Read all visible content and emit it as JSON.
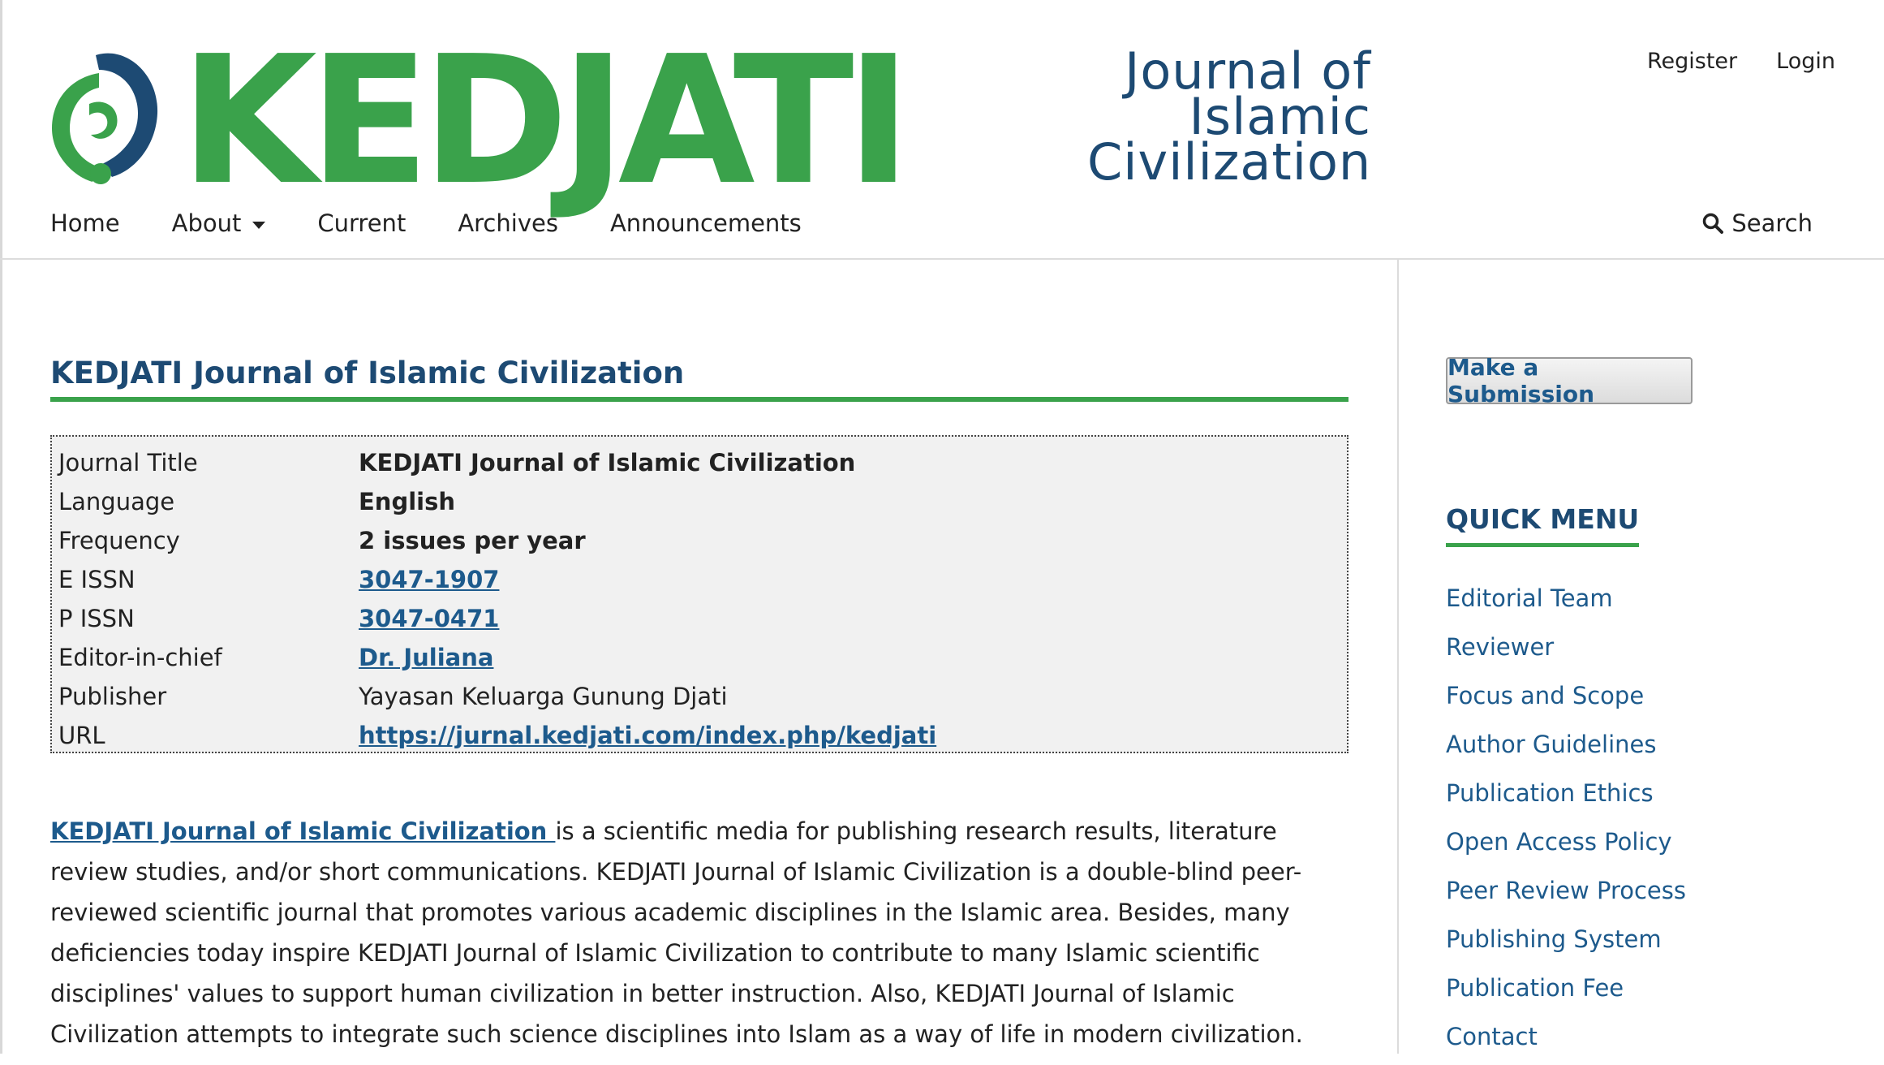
{
  "header": {
    "logo_text": "KEDJATI",
    "logo_sub_line1": "Journal of",
    "logo_sub_line2": "Islamic",
    "logo_sub_line3": "Civilization",
    "brand_green": "#3aa24b",
    "brand_blue": "#1d4a73"
  },
  "user_nav": {
    "register": "Register",
    "login": "Login"
  },
  "main_nav": {
    "home": "Home",
    "about": "About",
    "current": "Current",
    "archives": "Archives",
    "announcements": "Announcements",
    "search": "Search"
  },
  "main": {
    "title": "KEDJATI Journal of Islamic Civilization",
    "info": [
      {
        "label": "Journal Title",
        "value": "KEDJATI Journal of Islamic Civilization"
      },
      {
        "label": "Language",
        "value": "English"
      },
      {
        "label": "Frequency",
        "value": "2 issues per year"
      },
      {
        "label": "E ISSN",
        "value": "3047-1907"
      },
      {
        "label": "P ISSN",
        "value": "3047-0471"
      },
      {
        "label": "Editor-in-chief",
        "value": "Dr. Juliana"
      },
      {
        "label": "Publisher",
        "value": "Yayasan Keluarga Gunung Djati"
      },
      {
        "label": "URL",
        "value": "https://jurnal.kedjati.com/index.php/kedjati"
      }
    ],
    "desc_link": "KEDJATI Journal of Islamic Civilization ",
    "desc_text": "is a scientific media for publishing research results, literature review studies, and/or short communications. KEDJATI Journal of Islamic Civilization is a double-blind peer-reviewed scientific journal that promotes various academic disciplines in the Islamic area. Besides, many deficiencies today inspire KEDJATI Journal of Islamic Civilization to contribute to many Islamic scientific disciplines' values to support human civilization in better instruction. Also, KEDJATI Journal of Islamic Civilization attempts to integrate such science disciplines into Islam as a way of life in modern civilization."
  },
  "sidebar": {
    "submit_label": "Make a Submission",
    "quick_menu_title": "QUICK MENU",
    "items": [
      "Editorial Team",
      "Reviewer",
      "Focus and Scope",
      "Author Guidelines",
      "Publication Ethics",
      "Open Access Policy",
      "Peer Review Process",
      "Publishing System",
      "Publication Fee",
      "Contact"
    ]
  }
}
